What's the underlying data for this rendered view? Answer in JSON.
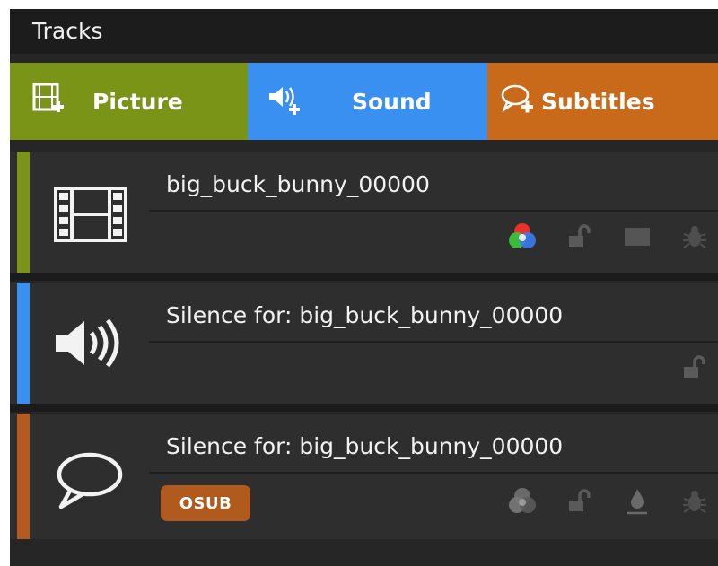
{
  "panel": {
    "title": "Tracks"
  },
  "tabs": [
    {
      "label": "Picture",
      "icon": "film-add-icon",
      "color": "#7a9418"
    },
    {
      "label": "Sound",
      "icon": "speaker-add-icon",
      "color": "#3a90f0"
    },
    {
      "label": "Subtitles",
      "icon": "speech-bubble-add-icon",
      "color": "#c96a1a"
    }
  ],
  "tracks": [
    {
      "type": "picture",
      "name": "big_buck_bunny_00000",
      "accent": "#7a9418",
      "icon": "film-icon",
      "actions": [
        "color-channels-icon",
        "lock-icon",
        "screen-icon",
        "bug-icon"
      ]
    },
    {
      "type": "sound",
      "name": "Silence for: big_buck_bunny_00000",
      "accent": "#3a90f0",
      "icon": "speaker-icon",
      "actions": [
        "lock-icon"
      ]
    },
    {
      "type": "subtitles",
      "name": "Silence for: big_buck_bunny_00000",
      "accent": "#b45a1e",
      "icon": "speech-bubble-icon",
      "badge": "OSUB",
      "actions": [
        "color-channels-icon",
        "lock-icon",
        "flame-icon",
        "bug-icon"
      ]
    }
  ]
}
